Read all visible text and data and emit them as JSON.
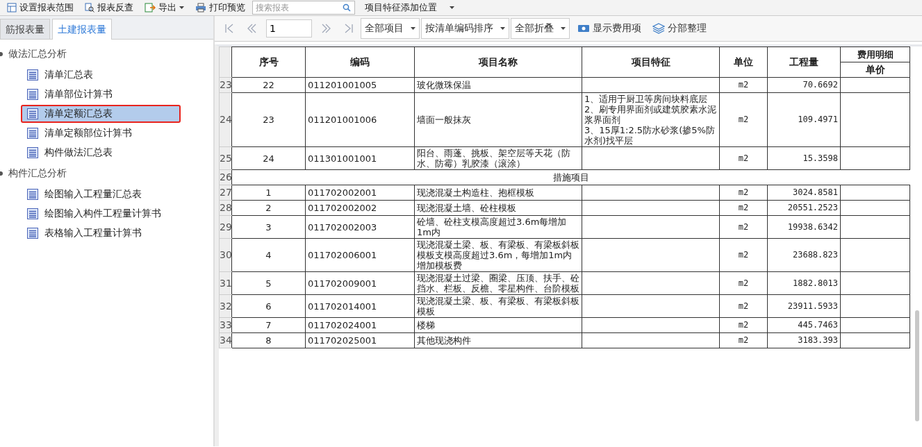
{
  "toolbar": {
    "items": [
      {
        "kind": "button",
        "label": "设置报表范围"
      },
      {
        "kind": "button",
        "label": "报表反查"
      },
      {
        "kind": "menu",
        "label": "导出"
      },
      {
        "kind": "button",
        "label": "打印预览"
      },
      {
        "kind": "search",
        "placeholder": "搜索报表"
      },
      {
        "kind": "dropdown",
        "label": "项目特征添加位置"
      }
    ]
  },
  "tabs": [
    {
      "label": "筋报表量",
      "selected": false
    },
    {
      "label": "土建报表量",
      "selected": true
    }
  ],
  "tree": [
    {
      "label": "做法汇总分析",
      "expanded": true,
      "children": [
        {
          "label": "清单汇总表",
          "selected": false
        },
        {
          "label": "清单部位计算书",
          "selected": false
        },
        {
          "label": "清单定额汇总表",
          "selected": true
        },
        {
          "label": "清单定额部位计算书",
          "selected": false
        },
        {
          "label": "构件做法汇总表",
          "selected": false
        }
      ]
    },
    {
      "label": "构件汇总分析",
      "expanded": true,
      "children": [
        {
          "label": "绘图输入工程量汇总表",
          "selected": false
        },
        {
          "label": "绘图输入构件工程量计算书",
          "selected": false
        },
        {
          "label": "表格输入工程量计算书",
          "selected": false
        }
      ]
    }
  ],
  "pager": {
    "page": "1"
  },
  "filters": [
    "全部项目",
    "按清单编码排序",
    "全部折叠"
  ],
  "actions": [
    {
      "label": "显示费用项"
    },
    {
      "label": "分部整理"
    }
  ],
  "table": {
    "columns": [
      "序号",
      "编码",
      "项目名称",
      "项目特征",
      "单位",
      "工程量"
    ],
    "group": {
      "label": "费用明细",
      "sub": "单价"
    },
    "rows": [
      {
        "kind": "item",
        "row_number": "23",
        "seq": "22",
        "code": "011201001005",
        "name": "玻化微珠保温",
        "feature": "",
        "unit": "m2",
        "quantity": "70.6692"
      },
      {
        "kind": "item",
        "row_number": "24",
        "seq": "23",
        "code": "011201001006",
        "name": "墙面一般抹灰",
        "feature": "1、适用于厨卫等房间块料底层\n2、刷专用界面剂或建筑胶素水泥浆界面剂\n3、15厚1:2.5防水砂浆(掺5%防水剂)找平层",
        "unit": "m2",
        "quantity": "109.4971"
      },
      {
        "kind": "item",
        "row_number": "25",
        "seq": "24",
        "code": "011301001001",
        "name": "阳台、雨蓬、挑板、架空层等天花（防水、防霉）乳胶漆（滚涂）",
        "feature": "",
        "unit": "m2",
        "quantity": "15.3598"
      },
      {
        "kind": "section",
        "row_number": "26",
        "label": "措施项目"
      },
      {
        "kind": "item",
        "row_number": "27",
        "seq": "1",
        "code": "011702002001",
        "name": "现浇混凝土构造柱、抱框模板",
        "feature": "",
        "unit": "m2",
        "quantity": "3024.8581"
      },
      {
        "kind": "item",
        "row_number": "28",
        "seq": "2",
        "code": "011702002002",
        "name": "现浇混凝土墙、砼柱模板",
        "feature": "",
        "unit": "m2",
        "quantity": "20551.2523"
      },
      {
        "kind": "item",
        "row_number": "29",
        "seq": "3",
        "code": "011702002003",
        "name": "砼墙、砼柱支模高度超过3.6m每增加1m内",
        "feature": "",
        "unit": "m2",
        "quantity": "19938.6342"
      },
      {
        "kind": "item",
        "row_number": "30",
        "seq": "4",
        "code": "011702006001",
        "name": "现浇混凝土梁、板、有梁板、有梁板斜板模板支模高度超过3.6m，每增加1m内增加模板费",
        "feature": "",
        "unit": "m2",
        "quantity": "23688.823"
      },
      {
        "kind": "item",
        "row_number": "31",
        "seq": "5",
        "code": "011702009001",
        "name": "现浇混凝土过梁、圈梁、压顶、扶手、砼挡水、栏板、反檐、零星构件、台阶模板",
        "feature": "",
        "unit": "m2",
        "quantity": "1882.8013"
      },
      {
        "kind": "item",
        "row_number": "32",
        "seq": "6",
        "code": "011702014001",
        "name": "现浇混凝土梁、板、有梁板、有梁板斜板模板",
        "feature": "",
        "unit": "m2",
        "quantity": "23911.5933"
      },
      {
        "kind": "item",
        "row_number": "33",
        "seq": "7",
        "code": "011702024001",
        "name": "楼梯",
        "feature": "",
        "unit": "m2",
        "quantity": "445.7463"
      },
      {
        "kind": "item",
        "row_number": "34",
        "seq": "8",
        "code": "011702025001",
        "name": "其他现浇构件",
        "feature": "",
        "unit": "m2",
        "quantity": "3183.393"
      }
    ]
  }
}
